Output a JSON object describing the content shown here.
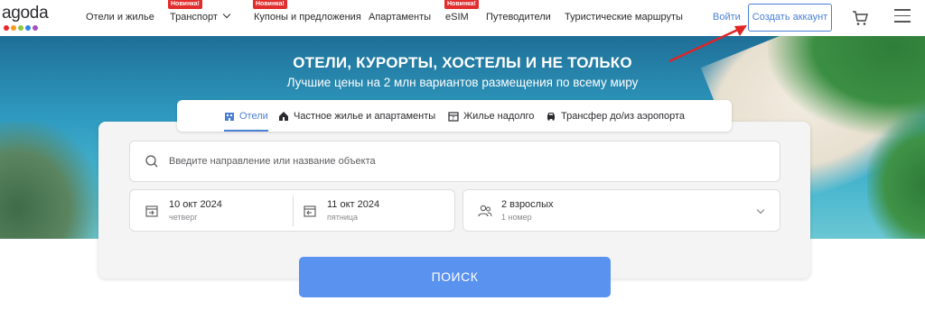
{
  "header": {
    "logo_text": "agoda",
    "logo_dots": [
      "#e6262a",
      "#f59a1f",
      "#8dc63f",
      "#2f87e8",
      "#a44fbf"
    ],
    "nav": [
      {
        "label": "Отели и жилье"
      },
      {
        "label": "Транспорт",
        "badge": "Новинка!",
        "icon": "chevron-down-icon"
      },
      {
        "label": "Купоны и предложения",
        "badge": "Новинка!"
      },
      {
        "label": "Апартаменты"
      },
      {
        "label": "eSIM",
        "badge": "Новинка!"
      },
      {
        "label": "Путеводители"
      },
      {
        "label": "Туристические маршруты"
      }
    ],
    "login_label": "Войти",
    "signup_label": "Создать аккаунт",
    "cart_icon": "cart-icon",
    "menu_icon": "hamburger-menu-icon"
  },
  "hero": {
    "title": "ОТЕЛИ, КУРОРТЫ, ХОСТЕЛЫ И НЕ ТОЛЬКО",
    "subtitle": "Лучшие цены на 2 млн вариантов размещения по всему миру"
  },
  "tabs": [
    {
      "label": "Отели",
      "icon": "hotel-icon",
      "active": true
    },
    {
      "label": "Частное жилье и апартаменты",
      "icon": "house-icon",
      "active": false
    },
    {
      "label": "Жилье надолго",
      "icon": "calendar-icon",
      "active": false
    },
    {
      "label": "Трансфер до/из аэропорта",
      "icon": "car-icon",
      "active": false
    }
  ],
  "search": {
    "destination_placeholder": "Введите направление или название объекта",
    "checkin": {
      "date": "10 окт 2024",
      "weekday": "четверг"
    },
    "checkout": {
      "date": "11 окт 2024",
      "weekday": "пятница"
    },
    "guests": {
      "adults": "2 взрослых",
      "rooms": "1 номер"
    },
    "button_label": "ПОИСК"
  },
  "colors": {
    "accent": "#4a7fd6",
    "search_button": "#5a92f0",
    "badge": "#e12d2d",
    "annotation_arrow": "#e02424"
  }
}
